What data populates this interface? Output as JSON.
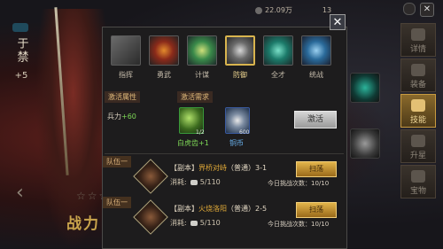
{
  "hero": {
    "name": "于禁",
    "level": "+5",
    "footer": "战力"
  },
  "topbar": {
    "resource": "22.09万",
    "count": "13"
  },
  "tabs": [
    {
      "label": "指挥",
      "active": false
    },
    {
      "label": "勇武",
      "active": false
    },
    {
      "label": "计谋",
      "active": false
    },
    {
      "label": "防御",
      "active": true
    },
    {
      "label": "全才",
      "active": false
    },
    {
      "label": "统战",
      "active": false
    }
  ],
  "sections": {
    "attr_label": "激活属性",
    "req_label": "激活需求"
  },
  "attr": {
    "name": "兵力",
    "value": "+60"
  },
  "requirements": [
    {
      "name": "白虎齿+1",
      "count": "1/2",
      "color": "#7ed957"
    },
    {
      "name": "铜币",
      "count": "600",
      "color": "#6ab3f0"
    }
  ],
  "activate_label": "激活",
  "squads": [
    {
      "team": "队伍一",
      "tag": "【副本】",
      "stage": "界桥对峙",
      "mode": "（普通）",
      "num": "3-1",
      "cost_label": "消耗:",
      "cost": "5/110",
      "btn": "扫荡",
      "daily": "今日挑战次数：10/10"
    },
    {
      "team": "队伍一",
      "tag": "【副本】",
      "stage": "火烧洛阳",
      "mode": "（普通）",
      "num": "2-5",
      "cost_label": "消耗:",
      "cost": "5/110",
      "btn": "扫荡",
      "daily": "今日挑战次数：10/10"
    }
  ],
  "sidebar": [
    {
      "label": "详情",
      "active": false
    },
    {
      "label": "装备",
      "active": false
    },
    {
      "label": "技能",
      "active": true
    },
    {
      "label": "升星",
      "active": false
    },
    {
      "label": "宝物",
      "active": false
    }
  ],
  "icons": {
    "close": "close-icon",
    "back": "chevron-left-icon"
  }
}
